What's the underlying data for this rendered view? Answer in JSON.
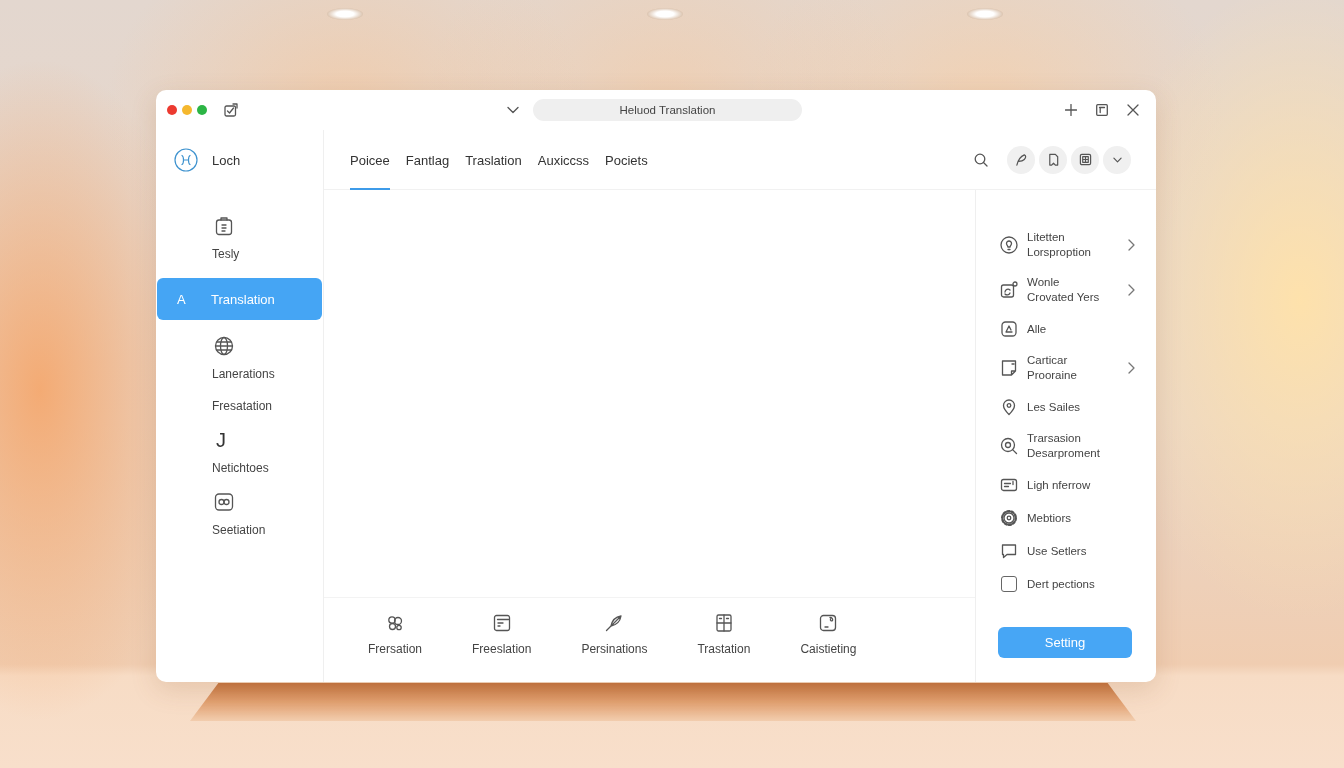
{
  "window": {
    "traffic_lights": [
      {
        "color": "#ec3a30"
      },
      {
        "color": "#f5b82e"
      },
      {
        "color": "#2cb545"
      }
    ],
    "address": "Heluod Translation"
  },
  "sidebar": {
    "brand": "Loch",
    "items": [
      {
        "kind": "clipboard",
        "label": "Tesly",
        "selected": false
      },
      {
        "kind": "glyph",
        "glyph": "A",
        "label": "Translation",
        "selected": true
      },
      {
        "kind": "globe",
        "label": "Lanerations",
        "selected": false
      },
      {
        "kind": "text",
        "label": "Fresatation",
        "selected": false
      },
      {
        "kind": "glyph",
        "glyph": "J",
        "label": "Netichtoes",
        "selected": false
      },
      {
        "kind": "badge",
        "label": "Seetiation",
        "selected": false
      }
    ]
  },
  "tabs": [
    {
      "label": "Poicee",
      "selected": true
    },
    {
      "label": "Fantlag",
      "selected": false
    },
    {
      "label": "Traslation",
      "selected": false
    },
    {
      "label": "Auxiccss",
      "selected": false
    },
    {
      "label": "Pociets",
      "selected": false
    }
  ],
  "toolbar": [
    {
      "kind": "cluster",
      "label": "Frersation"
    },
    {
      "kind": "note",
      "label": "Freeslation"
    },
    {
      "kind": "pen",
      "label": "Persinations"
    },
    {
      "kind": "grid",
      "label": "Trastation"
    },
    {
      "kind": "sticky",
      "label": "Caistieting"
    }
  ],
  "panel": {
    "items": [
      {
        "kind": "pincircle",
        "label": "Litetten\nLorsproption",
        "submenu": true
      },
      {
        "kind": "editsquare",
        "label": "Wonle\nCrovated Yers",
        "submenu": true
      },
      {
        "kind": "notesquare",
        "label": "Alle",
        "submenu": false
      },
      {
        "kind": "document",
        "label": "Carticar\nProoraine",
        "submenu": true
      },
      {
        "kind": "pin",
        "label": "Les Sailes",
        "submenu": false
      },
      {
        "kind": "searchcircle",
        "label": "Trarsasion\nDesarproment",
        "submenu": false
      },
      {
        "kind": "card",
        "label": "Ligh nferrow",
        "submenu": false
      },
      {
        "kind": "gear",
        "label": "Mebtiors",
        "submenu": false
      },
      {
        "kind": "chat",
        "label": "Use Setlers",
        "submenu": false
      },
      {
        "kind": "checkbox",
        "label": "Dert pections",
        "submenu": false,
        "checked": false
      }
    ],
    "button": "Setting"
  }
}
